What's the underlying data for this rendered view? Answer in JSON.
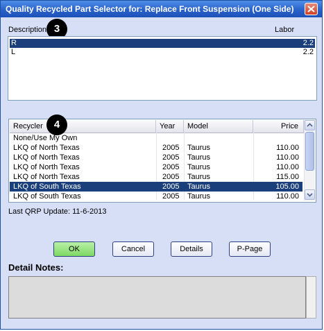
{
  "window": {
    "title": "Quality Recycled Part Selector for: Replace Front Suspension (One Side)"
  },
  "labor_list": {
    "header_description": "Description",
    "header_labor": "Labor",
    "callout": "3",
    "rows": [
      {
        "description": "R",
        "labor": "2.2",
        "selected": true
      },
      {
        "description": "L",
        "labor": "2.2",
        "selected": false
      }
    ]
  },
  "recycler_table": {
    "callout": "4",
    "columns": [
      "Recycler",
      "Year",
      "Model",
      "Price"
    ],
    "rows": [
      {
        "recycler": "None/Use My Own",
        "year": "",
        "model": "",
        "price": "",
        "selected": false
      },
      {
        "recycler": "LKQ of North Texas",
        "year": "2005",
        "model": "Taurus",
        "price": "110.00",
        "selected": false
      },
      {
        "recycler": "LKQ of North Texas",
        "year": "2005",
        "model": "Taurus",
        "price": "110.00",
        "selected": false
      },
      {
        "recycler": "LKQ of North Texas",
        "year": "2005",
        "model": "Taurus",
        "price": "110.00",
        "selected": false
      },
      {
        "recycler": "LKQ of North Texas",
        "year": "2005",
        "model": "Taurus",
        "price": "115.00",
        "selected": false
      },
      {
        "recycler": "LKQ of South Texas",
        "year": "2005",
        "model": "Taurus",
        "price": "105.00",
        "selected": true
      },
      {
        "recycler": "LKQ of South Texas",
        "year": "2005",
        "model": "Taurus",
        "price": "110.00",
        "selected": false
      }
    ]
  },
  "status": {
    "last_update": "Last QRP Update: 11-6-2013"
  },
  "buttons": {
    "ok": "OK",
    "cancel": "Cancel",
    "details": "Details",
    "ppage": "P-Page"
  },
  "notes": {
    "label": "Detail Notes:",
    "value": ""
  },
  "colors": {
    "selection": "#1a3f7a",
    "ok_button": "#9be784",
    "title_bar": "#2a62c9"
  }
}
